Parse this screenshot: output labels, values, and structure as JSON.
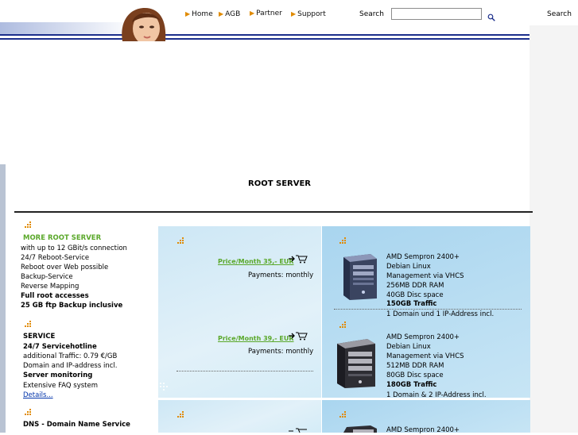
{
  "nav": {
    "items": [
      {
        "label": "Home"
      },
      {
        "label": "AGB"
      },
      {
        "label": "Partner"
      },
      {
        "label": "Support"
      }
    ]
  },
  "search": {
    "label": "Search",
    "right_label": "Search",
    "value": ""
  },
  "page": {
    "title": "ROOT SERVER"
  },
  "left": {
    "more_title": "MORE ROOT SERVER",
    "more_lines": [
      "with up to 12 GBit/s connection",
      "24/7 Reboot-Service",
      "Reboot over Web possible",
      "Backup-Service",
      "Reverse Mapping",
      "Full root accesses",
      "25 GB ftp Backup inclusive"
    ],
    "service_title": "SERVICE",
    "service_lines": [
      "24/7 Servicehotline",
      "additional Traffic: 0.79 €/GB",
      "Domain and IP-address incl.",
      "Server monitoring",
      "Extensive FAQ system"
    ],
    "details_link": "Details...",
    "dns_title": "DNS - Domain Name Service"
  },
  "products": [
    {
      "price": "Price/Month  35,- EUR",
      "payment": "Payments: monthly",
      "specs": [
        "AMD Sempron 2400+",
        "Debian Linux",
        "Management via  VHCS",
        "256MB DDR RAM",
        "40GB Disc space",
        "150GB Traffic",
        "1 Domain und 1 IP-Address incl."
      ]
    },
    {
      "price": "Price/Month  39,- EUR",
      "payment": "Payments: monthly",
      "specs": [
        "AMD Sempron 2400+",
        "Debian Linux",
        "Management via  VHCS",
        "512MB DDR RAM",
        "80GB Disc space",
        "180GB Traffic",
        "1 Domain & 2 IP-Address incl."
      ]
    },
    {
      "specs": [
        "AMD Sempron 2400+"
      ]
    }
  ],
  "colors": {
    "nav_line": "#1c2f8c",
    "accent_green": "#5aa82a",
    "accent_orange": "#e08a00",
    "panel_blue": "#cde7f5"
  }
}
